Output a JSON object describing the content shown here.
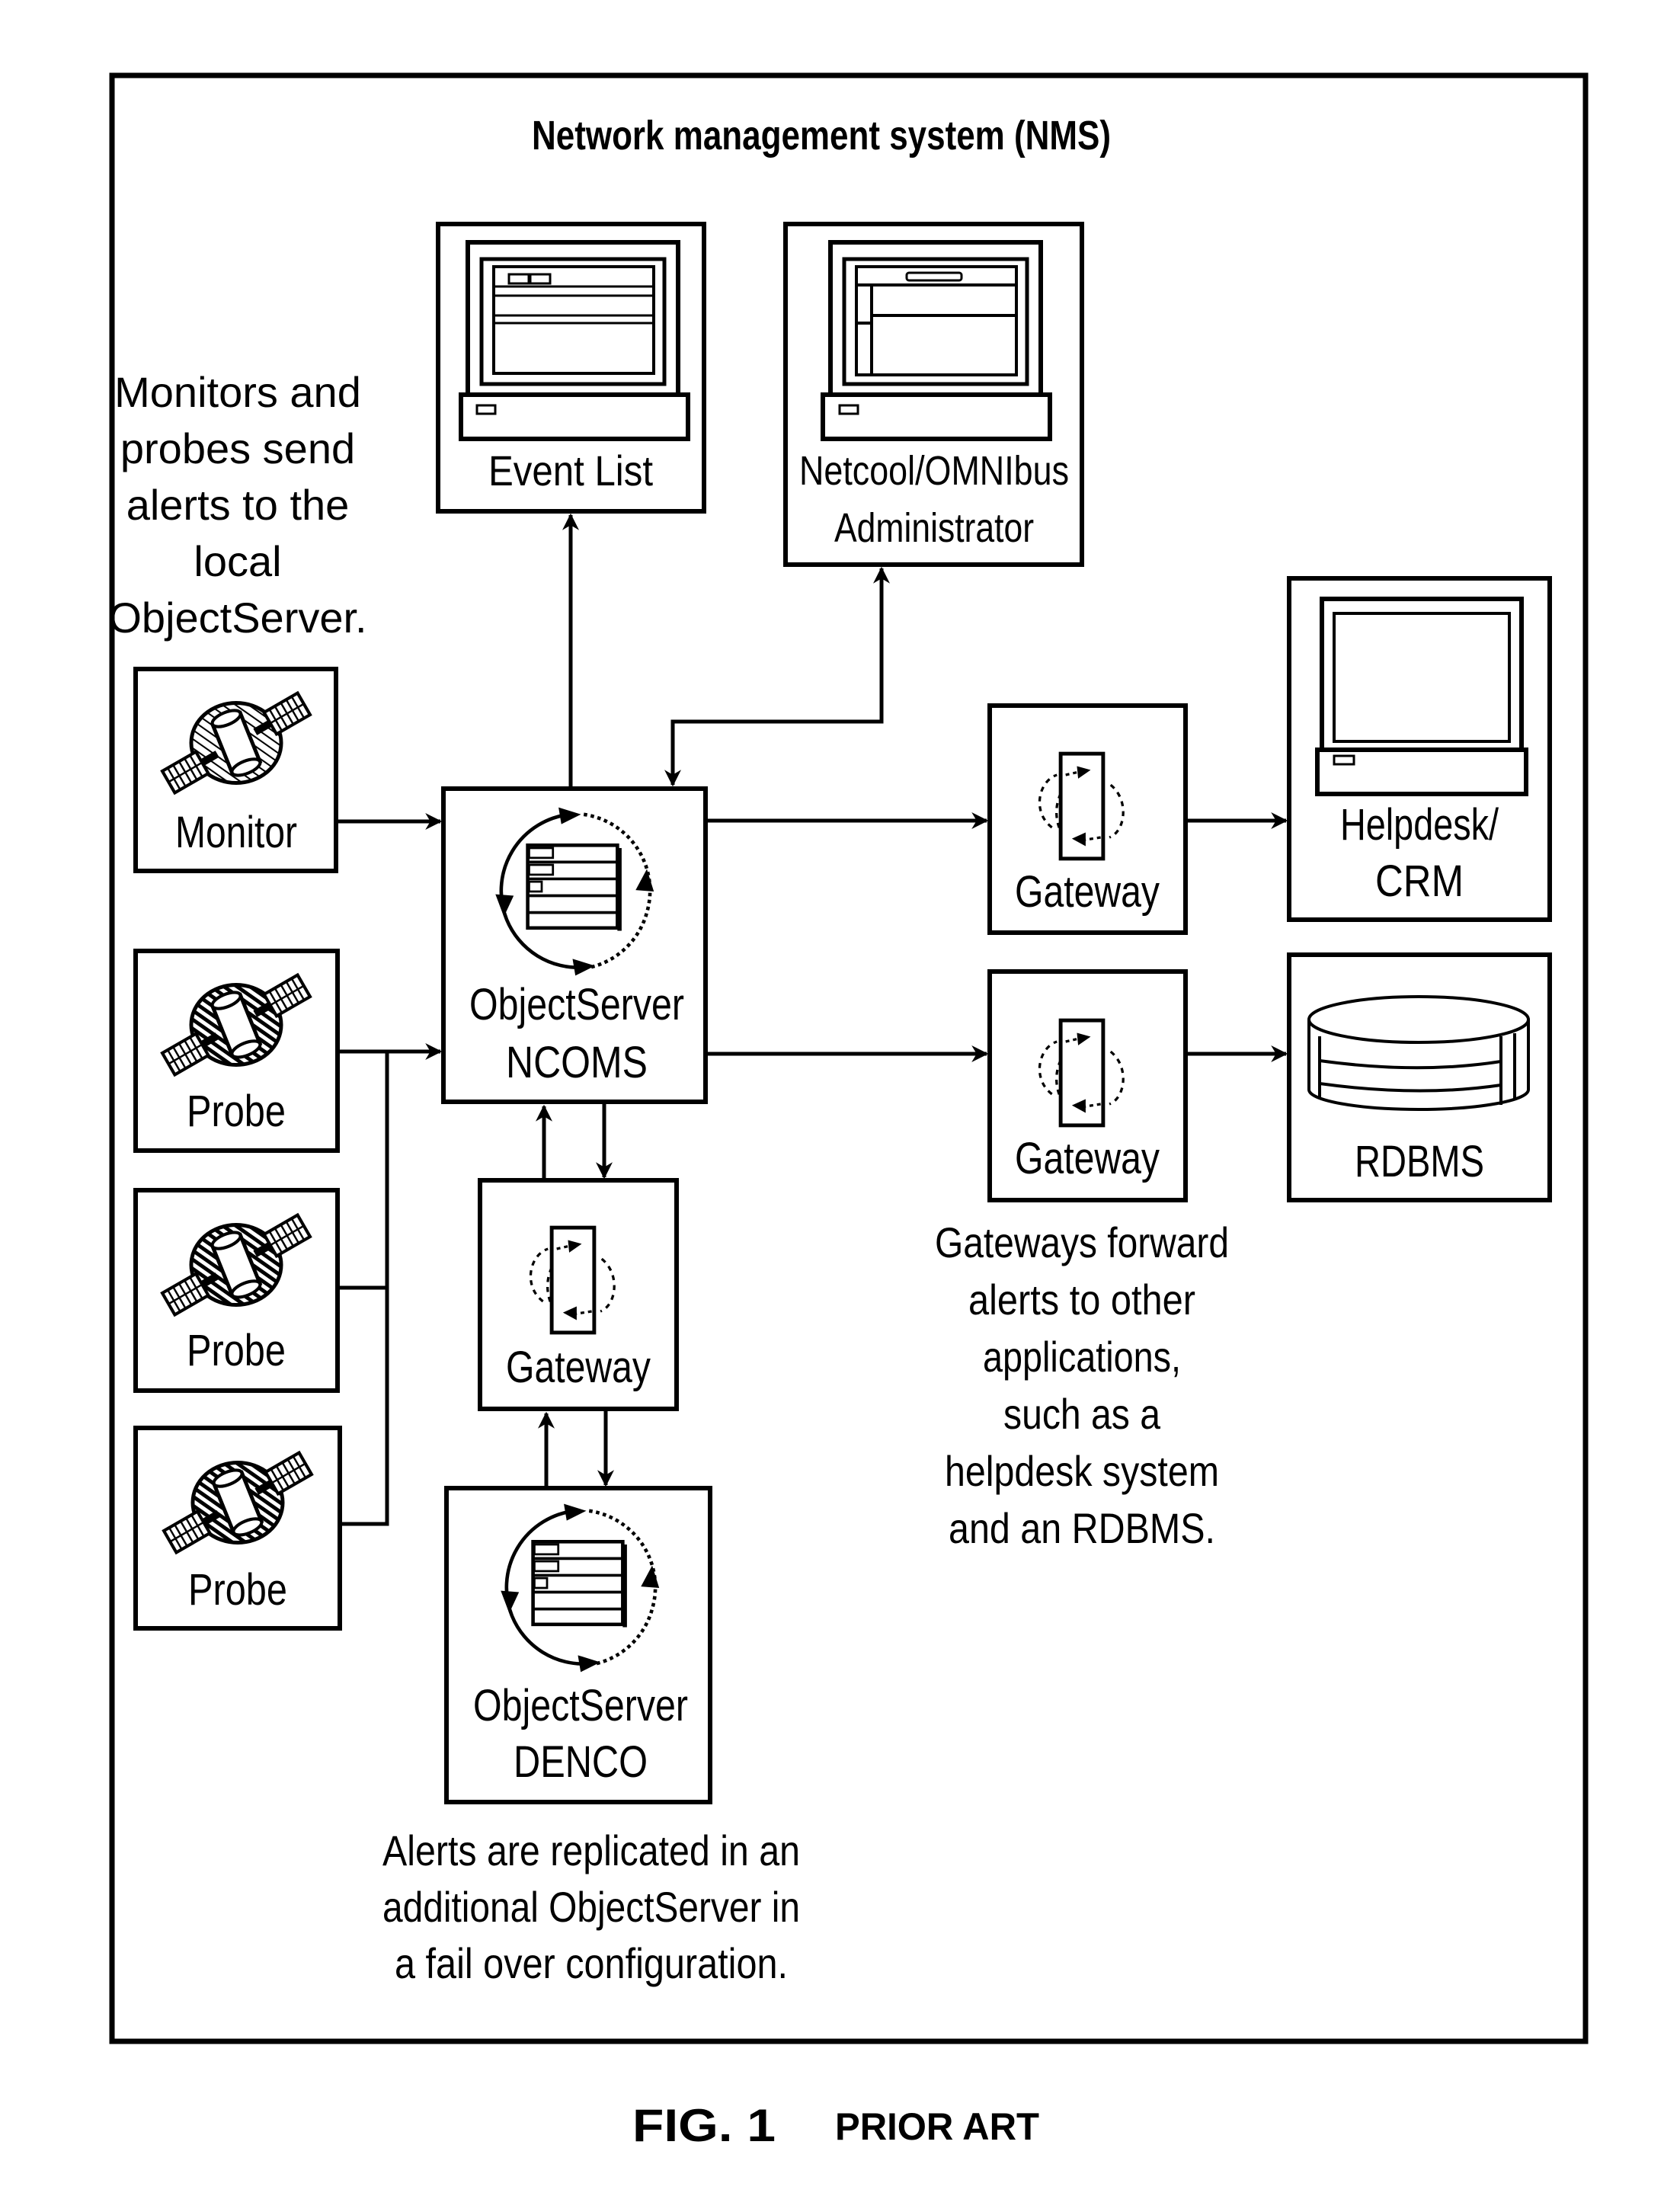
{
  "title": "Network management system (NMS)",
  "notes": {
    "monitors_probes": [
      "Monitors and",
      "probes send",
      "alerts to the",
      "local",
      "ObjectServer."
    ],
    "gateways_forward": [
      "Gateways forward",
      "alerts to other",
      "applications,",
      "such as a",
      "helpdesk system",
      "and an RDBMS."
    ],
    "replication": [
      "Alerts are replicated in an",
      "additional ObjectServer in",
      "a fail over configuration."
    ]
  },
  "nodes": {
    "event_list": {
      "label": [
        "Event List"
      ],
      "icon": "workstation-icon"
    },
    "administrator": {
      "label": [
        "Netcool/OMNIbus",
        "Administrator"
      ],
      "icon": "workstation-icon"
    },
    "monitor": {
      "label": [
        "Monitor"
      ],
      "icon": "satellite-icon"
    },
    "probe_1": {
      "label": [
        "Probe"
      ],
      "icon": "satellite-icon"
    },
    "probe_2": {
      "label": [
        "Probe"
      ],
      "icon": "satellite-icon"
    },
    "probe_3": {
      "label": [
        "Probe"
      ],
      "icon": "satellite-icon"
    },
    "objectserver_ncoms": {
      "label": [
        "ObjectServer",
        "NCOMS"
      ],
      "icon": "objectserver-cycle-icon"
    },
    "objectserver_denco": {
      "label": [
        "ObjectServer",
        "DENCO"
      ],
      "icon": "objectserver-cycle-icon"
    },
    "gateway_helpdesk": {
      "label": [
        "Gateway"
      ],
      "icon": "gateway-icon"
    },
    "gateway_rdbms": {
      "label": [
        "Gateway"
      ],
      "icon": "gateway-icon"
    },
    "gateway_failover": {
      "label": [
        "Gateway"
      ],
      "icon": "gateway-icon"
    },
    "helpdesk": {
      "label": [
        "Helpdesk/",
        "CRM"
      ],
      "icon": "workstation-icon"
    },
    "rdbms": {
      "label": [
        "RDBMS"
      ],
      "icon": "database-icon"
    }
  },
  "edges": [
    {
      "from": "monitor",
      "to": "objectserver_ncoms"
    },
    {
      "from": "probe_1",
      "to": "objectserver_ncoms"
    },
    {
      "from": "probe_2",
      "to": "objectserver_ncoms"
    },
    {
      "from": "probe_3",
      "to": "objectserver_ncoms"
    },
    {
      "from": "objectserver_ncoms",
      "to": "event_list"
    },
    {
      "from": "objectserver_ncoms",
      "to": "administrator",
      "bidirectional": true
    },
    {
      "from": "objectserver_ncoms",
      "to": "gateway_helpdesk"
    },
    {
      "from": "gateway_helpdesk",
      "to": "helpdesk"
    },
    {
      "from": "objectserver_ncoms",
      "to": "gateway_rdbms"
    },
    {
      "from": "gateway_rdbms",
      "to": "rdbms"
    },
    {
      "from": "objectserver_ncoms",
      "to": "gateway_failover",
      "bidirectional": true
    },
    {
      "from": "gateway_failover",
      "to": "objectserver_denco",
      "bidirectional": true
    }
  ],
  "caption": {
    "figure": "FIG. 1",
    "note": "PRIOR ART"
  }
}
